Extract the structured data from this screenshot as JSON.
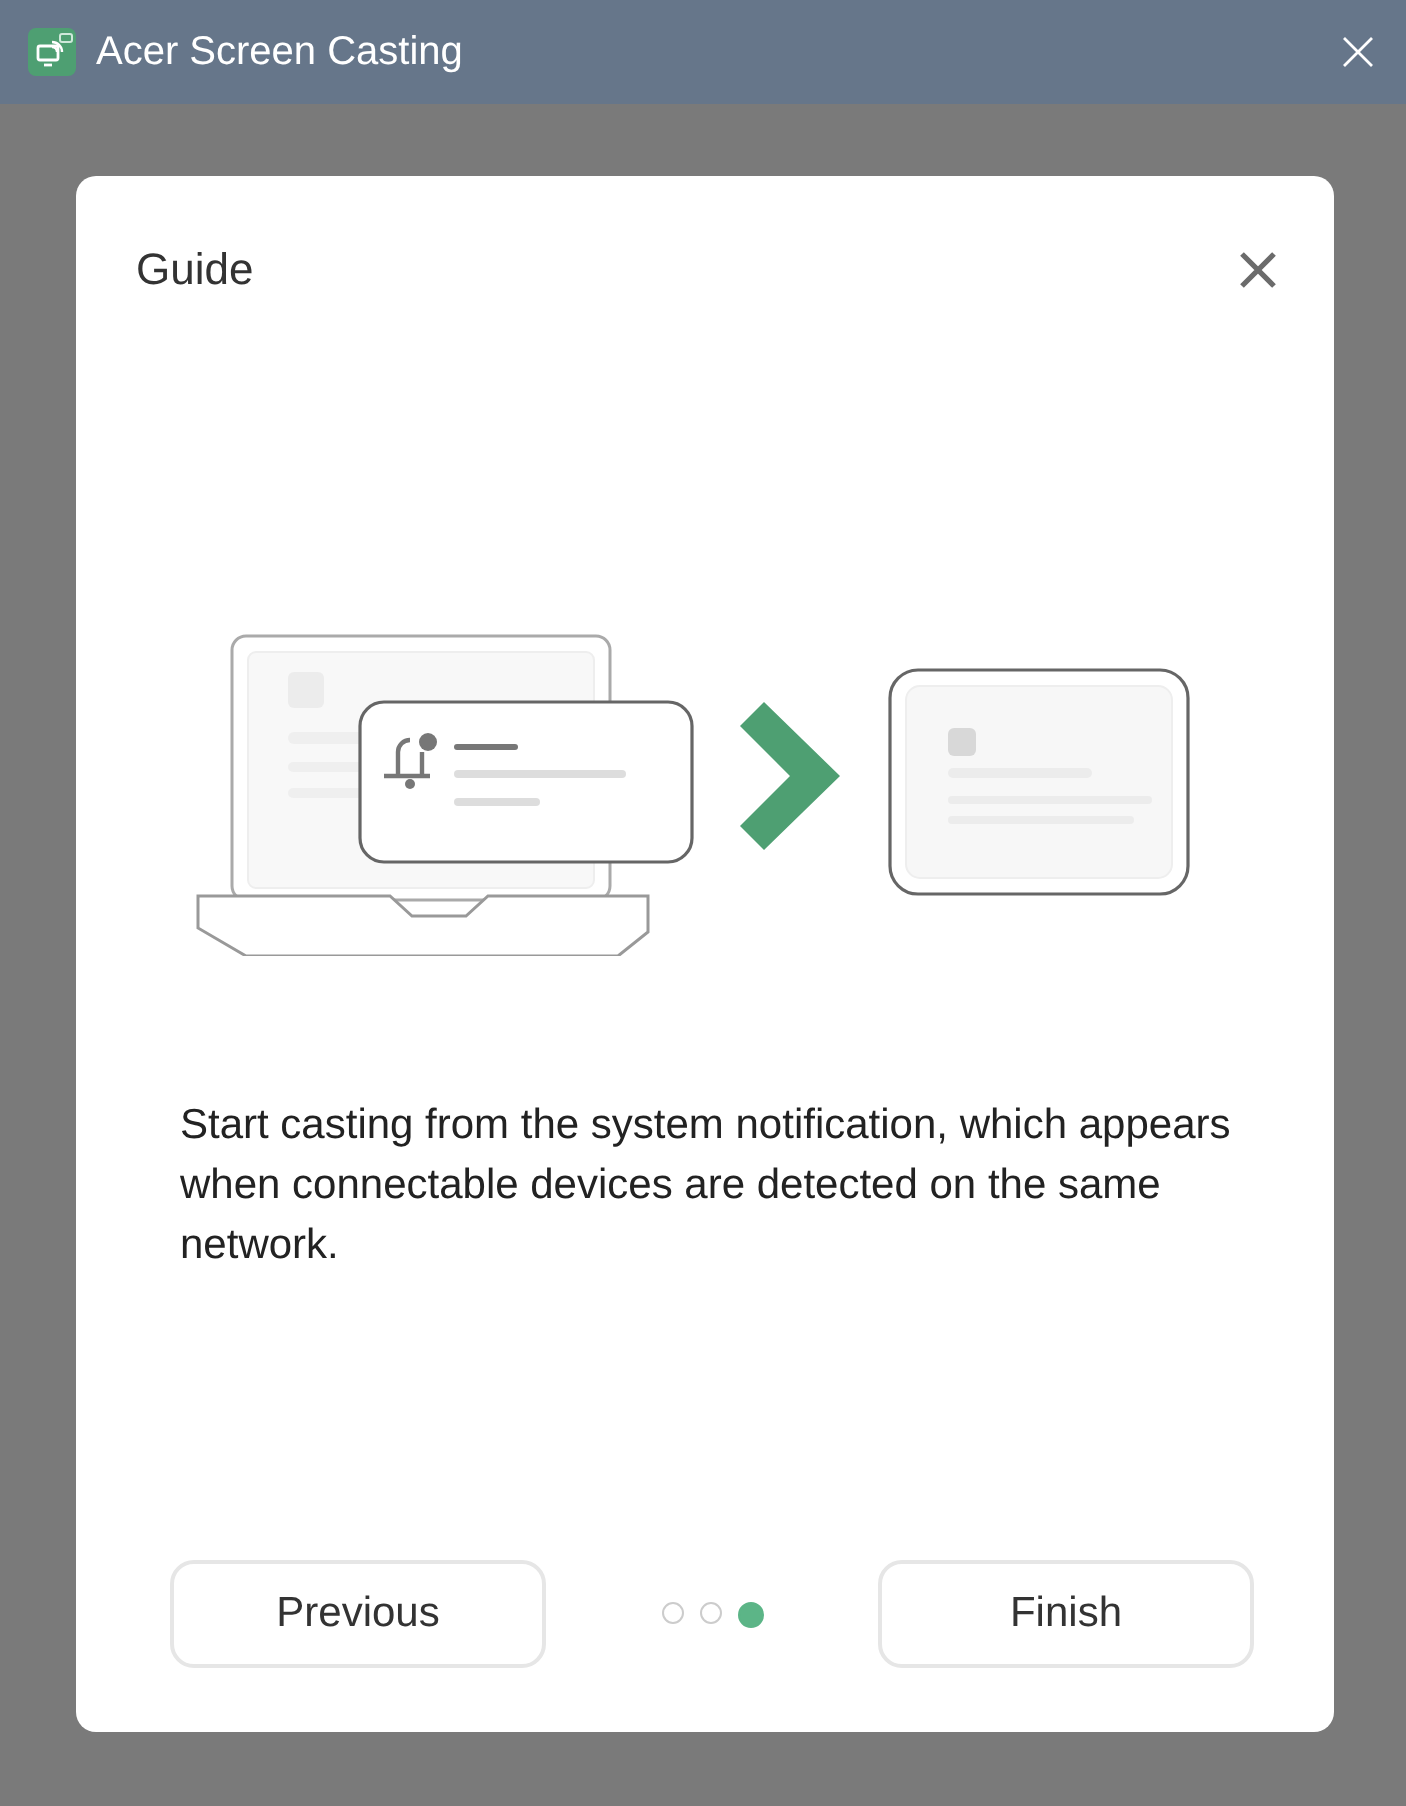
{
  "window": {
    "title": "Acer Screen Casting"
  },
  "dialog": {
    "title": "Guide",
    "description": "Start casting from the system notification, which appears when connectable devices are detected on the same network.",
    "steps": [
      {
        "selected": false
      },
      {
        "selected": false
      },
      {
        "selected": true
      }
    ],
    "buttons": [
      "Previous",
      "Finish"
    ]
  }
}
